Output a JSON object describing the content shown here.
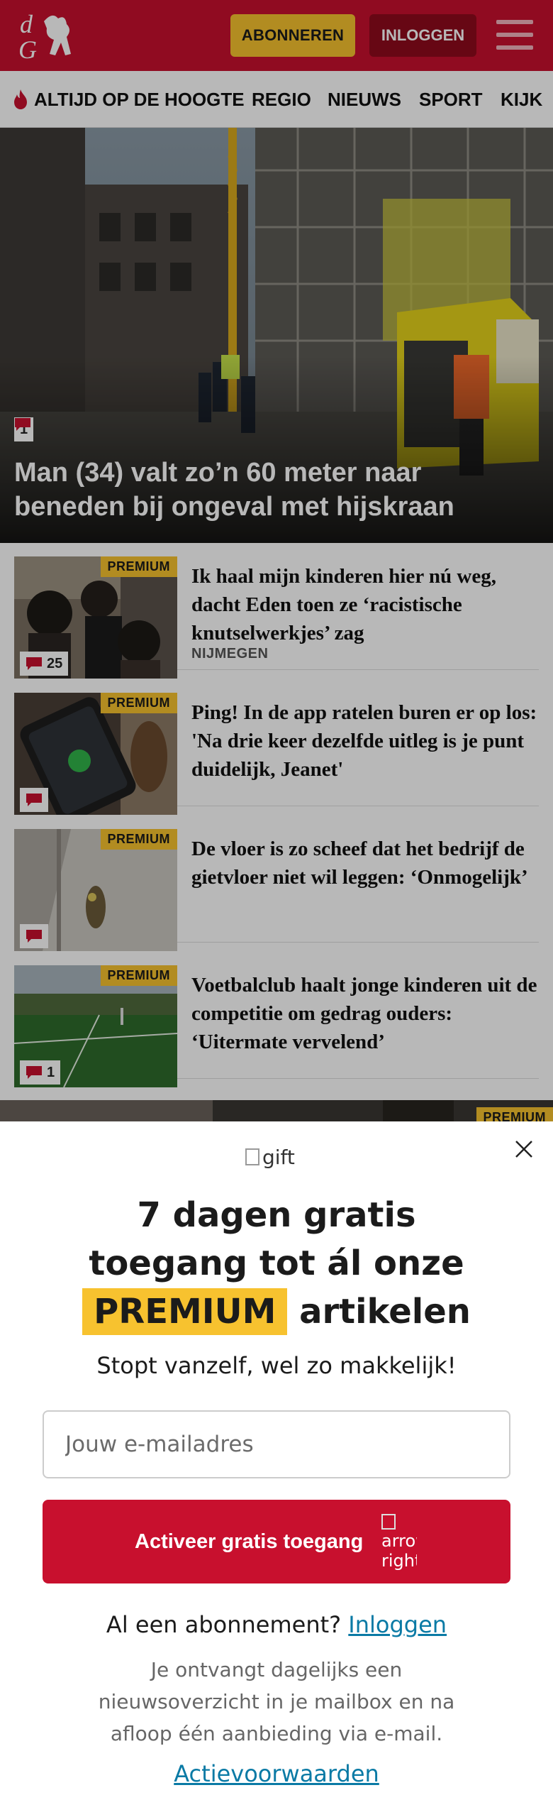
{
  "header": {
    "logo_alt": "dG",
    "subscribe_label": "ABONNEREN",
    "login_label": "INLOGGEN",
    "menu_icon": "hamburger-menu-icon",
    "brand_color": "#c8102e",
    "accent_color": "#f7c22f"
  },
  "nav": {
    "items": [
      {
        "label": "ALTIJD OP DE HOOGTE",
        "icon": "flame-icon"
      },
      {
        "label": "REGIO"
      },
      {
        "label": "NIEUWS"
      },
      {
        "label": "SPORT"
      },
      {
        "label": "KIJK"
      }
    ]
  },
  "hero": {
    "title": "Man (34) valt zo’n 60 meter naar beneden bij ongeval met hijskraan",
    "comments": "1"
  },
  "articles": [
    {
      "badge": "PREMIUM",
      "title": "Ik haal mijn kinderen hier nú weg, dacht Eden toen ze ‘racistische knutselwerkjes’ zag",
      "meta": "NIJMEGEN",
      "comments": "25"
    },
    {
      "badge": "PREMIUM",
      "title": "Ping! In de app ratelen buren er op los: 'Na drie keer dezelfde uitleg is je punt duidelijk, Jeanet'",
      "comments": ""
    },
    {
      "badge": "PREMIUM",
      "title": "De vloer is zo scheef dat het bedrijf de gietvloer niet wil leggen: ‘Onmogelijk’",
      "comments": ""
    },
    {
      "badge": "PREMIUM",
      "title": "Voetbalclub haalt jonge kinderen uit de competitie om gedrag ouders: ‘Uitermate vervelend’",
      "comments": "1"
    }
  ],
  "next_article_badge": "PREMIUM",
  "modal": {
    "gift_alt": "gift",
    "heading_line1": "7 dagen gratis",
    "heading_line2": "toegang tot ál onze",
    "heading_premium": "PREMIUM",
    "heading_line3_rest": "artikelen",
    "subline": "Stopt vanzelf, wel zo makkelijk!",
    "email_placeholder": "Jouw e-mailadres",
    "cta_label": "Activeer gratis toegang",
    "cta_arrow_alt": "arrow right",
    "login_prompt": "Al een abonnement?",
    "login_link": "Inloggen",
    "disclaimer": "Je ontvangt dagelijks een nieuwsoverzicht in je mailbox en na afloop één aanbieding via e-mail.",
    "terms_link": "Actievoorwaarden"
  }
}
